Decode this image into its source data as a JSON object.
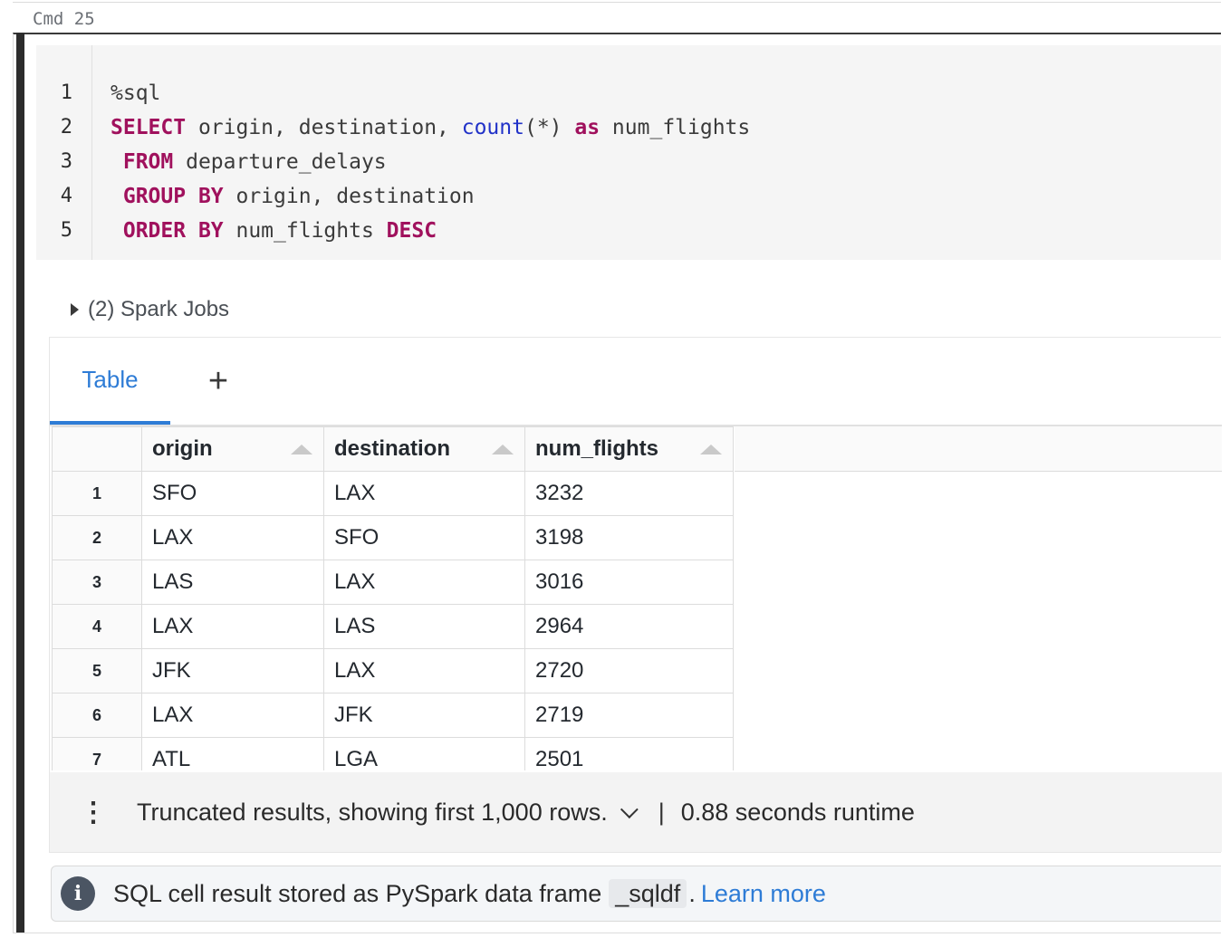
{
  "cell": {
    "label": "Cmd 25"
  },
  "editor": {
    "line_numbers": [
      "1",
      "2",
      "3",
      "4",
      "5"
    ],
    "lines": [
      [
        {
          "t": "%sql",
          "c": "plain"
        }
      ],
      [
        {
          "t": "SELECT",
          "c": "kw"
        },
        {
          "t": " origin, destination, ",
          "c": "plain"
        },
        {
          "t": "count",
          "c": "fn"
        },
        {
          "t": "(*) ",
          "c": "plain"
        },
        {
          "t": "as",
          "c": "kw"
        },
        {
          "t": " num_flights",
          "c": "plain"
        }
      ],
      [
        {
          "t": " ",
          "c": "plain"
        },
        {
          "t": "FROM",
          "c": "kw"
        },
        {
          "t": " departure_delays",
          "c": "plain"
        }
      ],
      [
        {
          "t": " ",
          "c": "plain"
        },
        {
          "t": "GROUP BY",
          "c": "kw"
        },
        {
          "t": " origin, destination",
          "c": "plain"
        }
      ],
      [
        {
          "t": " ",
          "c": "plain"
        },
        {
          "t": "ORDER BY",
          "c": "kw"
        },
        {
          "t": " num_flights ",
          "c": "plain"
        },
        {
          "t": "DESC",
          "c": "kw"
        }
      ]
    ]
  },
  "spark_jobs": {
    "label": "(2) Spark Jobs"
  },
  "tabs": {
    "table_label": "Table",
    "add_label": "+"
  },
  "table": {
    "columns": [
      "origin",
      "destination",
      "num_flights"
    ],
    "rows": [
      [
        "1",
        "SFO",
        "LAX",
        "3232"
      ],
      [
        "2",
        "LAX",
        "SFO",
        "3198"
      ],
      [
        "3",
        "LAS",
        "LAX",
        "3016"
      ],
      [
        "4",
        "LAX",
        "LAS",
        "2964"
      ],
      [
        "5",
        "JFK",
        "LAX",
        "2720"
      ],
      [
        "6",
        "LAX",
        "JFK",
        "2719"
      ],
      [
        "7",
        "ATL",
        "LGA",
        "2501"
      ]
    ]
  },
  "footer": {
    "truncated": "Truncated results, showing first 1,000 rows.",
    "separator": "|",
    "runtime": "0.88 seconds runtime"
  },
  "info": {
    "text": "SQL cell result stored as PySpark data frame",
    "code": "_sqldf",
    "period": ".",
    "link": "Learn more"
  },
  "colors": {
    "accent": "#2e7cd6",
    "keyword": "#a0115d",
    "function": "#2132c8"
  }
}
